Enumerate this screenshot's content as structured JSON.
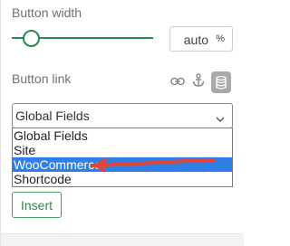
{
  "button_width": {
    "label": "Button width",
    "slider_value_fraction": 0.12,
    "value": "auto",
    "unit": "%"
  },
  "button_link": {
    "label": "Button link",
    "icons": [
      "link-icon",
      "anchor-icon",
      "database-icon"
    ]
  },
  "select": {
    "selected": "Global Fields",
    "options": [
      "Global Fields",
      "Site",
      "WooCommerce",
      "Shortcode"
    ],
    "highlighted": "WooCommerce"
  },
  "insert_label": "Insert",
  "colors": {
    "accent": "#2a8a4a",
    "highlight": "#2f80e5",
    "annotation_arrow": "#e0463c"
  }
}
